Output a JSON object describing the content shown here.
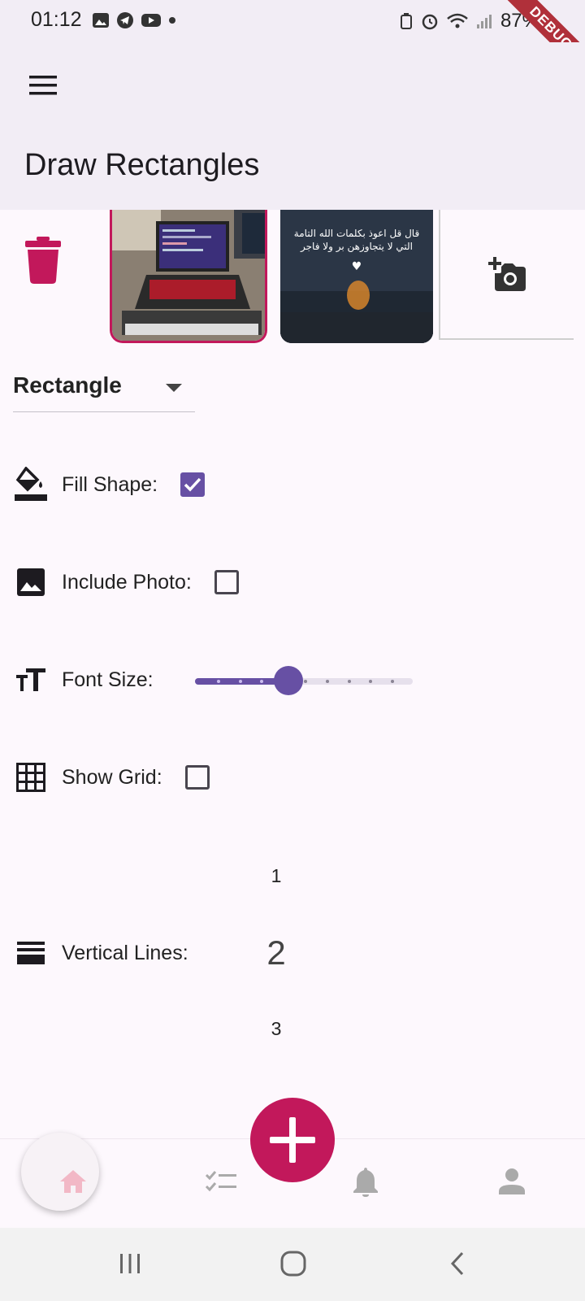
{
  "status_bar": {
    "time": "01:12",
    "battery": "87%"
  },
  "debug_ribbon": "DEBUG",
  "app_bar": {
    "title": "Draw Rectangles"
  },
  "photos": {
    "thumb2_caption_line1": "قال قل اعوذ بكلمات الله التامة",
    "thumb2_caption_line2": "التي لا يتجاوزهن بر ولا فاجر"
  },
  "shape_dropdown": {
    "selected": "Rectangle"
  },
  "options": {
    "fill_shape": {
      "label": "Fill Shape:",
      "checked": true
    },
    "include_photo": {
      "label": "Include Photo:",
      "checked": false
    },
    "font_size": {
      "label": "Font Size:",
      "slider_fraction": 0.4,
      "divisions": 10
    },
    "show_grid": {
      "label": "Show Grid:",
      "checked": false
    },
    "vertical_lines": {
      "label": "Vertical Lines:",
      "picker_values": [
        "1",
        "2",
        "3"
      ],
      "selected": "2"
    }
  },
  "colors": {
    "accent": "#c2185b",
    "primary": "#6750a4",
    "surface": "#f2edf5"
  },
  "bottom_nav": {
    "items": [
      "home-icon",
      "checklist-icon",
      "bell-icon",
      "person-icon"
    ],
    "active": "home-icon"
  }
}
